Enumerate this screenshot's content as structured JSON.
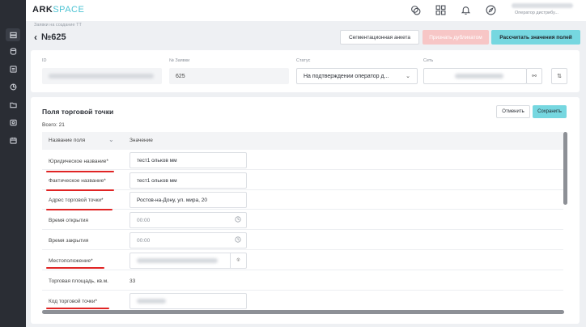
{
  "app": {
    "logo_a": "ARK",
    "logo_b": "SPACE"
  },
  "header": {
    "user_role": "Оператор дистрибу..."
  },
  "breadcrumb": "Заявки на создание ТТ",
  "page": {
    "title": "№625"
  },
  "actions": {
    "segment_label": "Сегментационная анкета",
    "add_label": "Признать дубликатом",
    "calc_label": "Рассчитать значения полей"
  },
  "summary": {
    "id_label": "ID",
    "num_label": "№ Заявки",
    "num_value": "625",
    "status_label": "Статус",
    "status_value": "На подтверждении оператор д...",
    "network_label": "Сеть"
  },
  "fields_card": {
    "title": "Поля торговой точки",
    "total": "Всего: 21",
    "cancel_label": "Отменить",
    "save_label": "Сохранить",
    "col_name": "Название поля",
    "col_value": "Значение",
    "rows": [
      {
        "label": "Юридическое название*",
        "value": "тест1 ольков мм"
      },
      {
        "label": "Фактическое название*",
        "value": "тест1 ольков мм"
      },
      {
        "label": "Адрес торговой точки*",
        "value": "Ростов-на-Дону, ул. мира, 20"
      },
      {
        "label": "Время открытия",
        "value": "00:00"
      },
      {
        "label": "Время закрытия",
        "value": "00:00"
      },
      {
        "label": "Местоположение*",
        "value": ""
      },
      {
        "label": "Торговая площадь, кв.м.",
        "value": "33"
      },
      {
        "label": "Код торговой точки*",
        "value": ""
      }
    ]
  },
  "colors": {
    "accent": "#76d7e0",
    "danger_soft": "#f7c6c6",
    "underline": "#e02424",
    "sidebar": "#2a2d34"
  }
}
